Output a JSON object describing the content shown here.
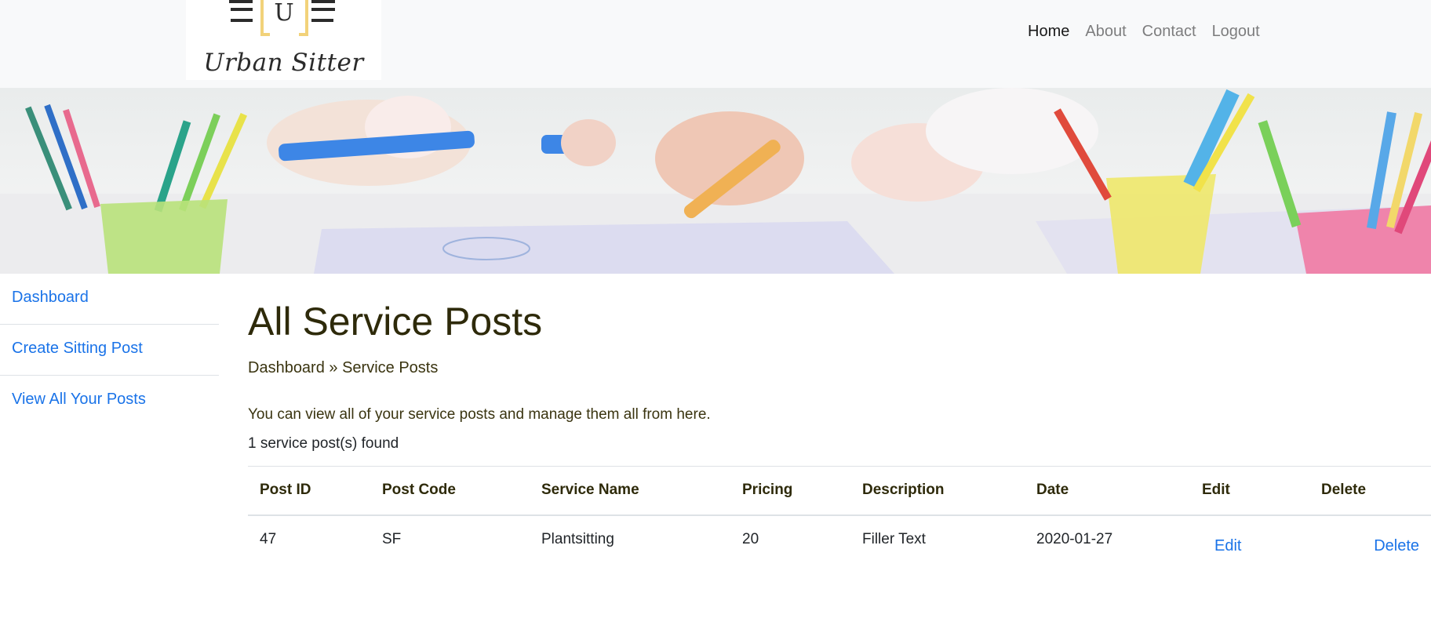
{
  "brand": {
    "name": "Urban Sitter",
    "logo_letter": "U"
  },
  "nav": {
    "items": [
      {
        "label": "Home",
        "active": true
      },
      {
        "label": "About",
        "active": false
      },
      {
        "label": "Contact",
        "active": false
      },
      {
        "label": "Logout",
        "active": false
      }
    ]
  },
  "sidebar": {
    "items": [
      {
        "label": "Dashboard"
      },
      {
        "label": "Create Sitting Post"
      },
      {
        "label": "View All Your Posts"
      }
    ]
  },
  "main": {
    "title": "All Service Posts",
    "breadcrumb": "Dashboard » Service Posts",
    "intro": "You can view all of your service posts and manage them all from here.",
    "count": "1 service post(s) found"
  },
  "table": {
    "headers": [
      "Post ID",
      "Post Code",
      "Service Name",
      "Pricing",
      "Description",
      "Date",
      "Edit",
      "Delete"
    ],
    "rows": [
      {
        "post_id": "47",
        "post_code": "SF",
        "service_name": "Plantsitting",
        "pricing": "20",
        "description": "Filler Text",
        "date": "2020-01-27",
        "edit": "Edit",
        "delete": "Delete"
      }
    ]
  },
  "colors": {
    "link": "#1a73e8",
    "heading": "#2e2a0a",
    "navbar_bg": "#f8f9fa",
    "logo_accent": "#f2d27a"
  }
}
